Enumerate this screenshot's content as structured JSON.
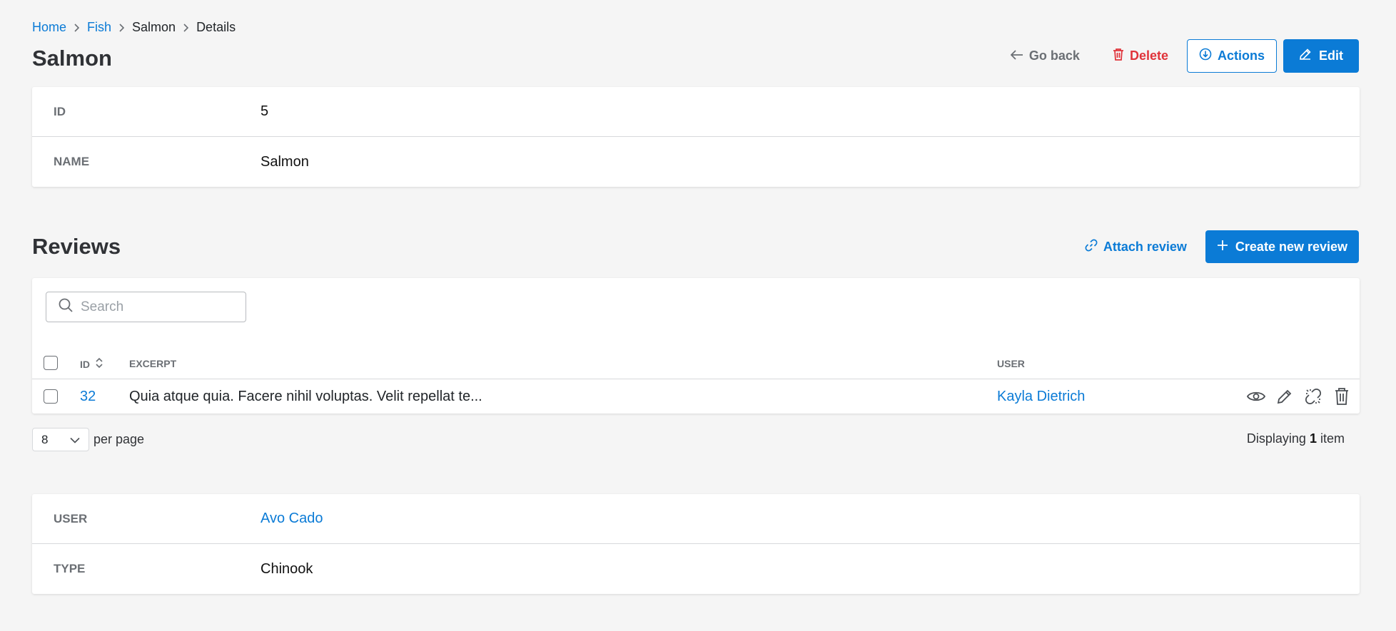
{
  "breadcrumb": {
    "home": "Home",
    "fish": "Fish",
    "salmon": "Salmon",
    "details": "Details"
  },
  "page": {
    "title": "Salmon"
  },
  "header_actions": {
    "go_back": "Go back",
    "delete": "Delete",
    "actions": "Actions",
    "edit": "Edit"
  },
  "details": [
    {
      "label": "ID",
      "value": "5"
    },
    {
      "label": "NAME",
      "value": "Salmon"
    }
  ],
  "reviews": {
    "title": "Reviews",
    "attach": "Attach review",
    "create": "Create new review",
    "search_placeholder": "Search",
    "columns": {
      "id": "ID",
      "excerpt": "EXCERPT",
      "user": "USER"
    },
    "rows": [
      {
        "id": "32",
        "excerpt": "Quia atque quia. Facere nihil voluptas. Velit repellat te...",
        "user": "Kayla Dietrich"
      }
    ],
    "per_page_value": "8",
    "per_page_label": "per page",
    "displaying_prefix": "Displaying",
    "displaying_count": "1",
    "displaying_suffix": "item"
  },
  "extra": [
    {
      "label": "USER",
      "value": "Avo Cado"
    },
    {
      "label": "TYPE",
      "value": "Chinook"
    }
  ],
  "colors": {
    "accent": "#0b7bd6",
    "danger": "#e0333a",
    "background": "#f5f5f5"
  }
}
